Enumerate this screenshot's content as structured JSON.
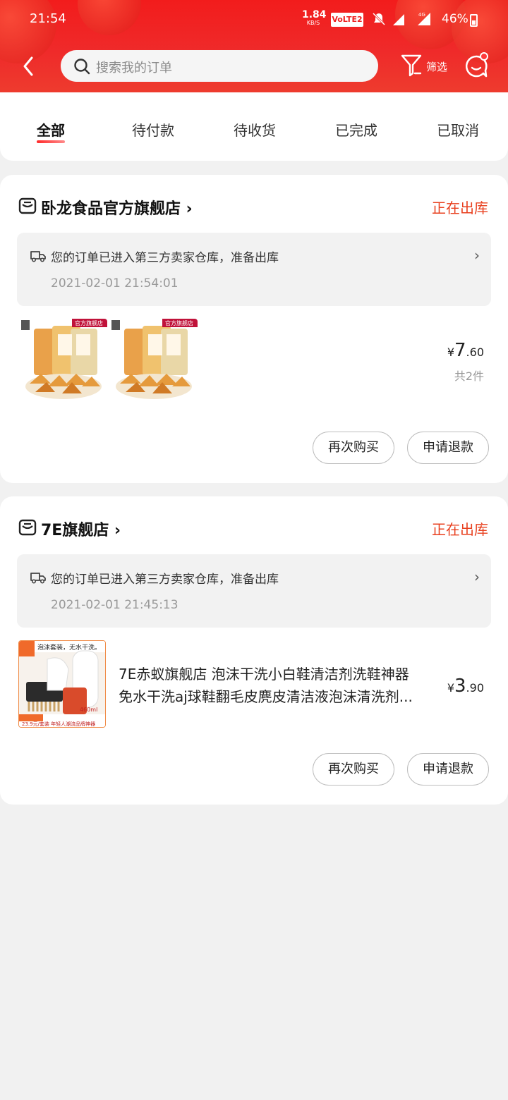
{
  "status_bar": {
    "time": "21:54",
    "net_speed": "1.84",
    "net_speed_unit": "KB/S",
    "volte": "VoLTE2",
    "battery": "46%",
    "icons": [
      "mute-icon",
      "signal-icon",
      "signal-4g-icon",
      "battery-icon"
    ]
  },
  "header": {
    "search_placeholder": "搜索我的订单",
    "filter_label": "筛选",
    "accent_color": "#f21c1c"
  },
  "tabs": [
    {
      "label": "全部",
      "active": true
    },
    {
      "label": "待付款",
      "active": false
    },
    {
      "label": "待收货",
      "active": false
    },
    {
      "label": "已完成",
      "active": false
    },
    {
      "label": "已取消",
      "active": false
    }
  ],
  "orders": [
    {
      "store": "卧龙食品官方旗舰店",
      "status": "正在出库",
      "logistics_text": "您的订单已进入第三方卖家仓库，准备出库",
      "logistics_time": "2021-02-01 21:54:01",
      "thumb_badge": "官方旗舰店",
      "price_currency": "¥",
      "price_int": "7",
      "price_dec": ".60",
      "quantity": "共2件",
      "buttons": [
        "再次购买",
        "申请退款"
      ]
    },
    {
      "store": "7E旗舰店",
      "status": "正在出库",
      "logistics_text": "您的订单已进入第三方卖家仓库，准备出库",
      "logistics_time": "2021-02-01 21:45:13",
      "product_title_line1": "7E赤蚁旗舰店 泡沫干洗小白鞋清洁剂洗鞋神器",
      "product_title_line2": "免水干洗aj球鞋翻毛皮麂皮清洁液泡沫清洗剂...",
      "thumb_caption": "泡沫套装，无水干洗。",
      "thumb_footer": "23.9元/套装  年轻人潮流品牌神器",
      "thumb_volume": "460ml",
      "price_currency": "¥",
      "price_int": "3",
      "price_dec": ".90",
      "buttons": [
        "再次购买",
        "申请退款"
      ]
    }
  ]
}
